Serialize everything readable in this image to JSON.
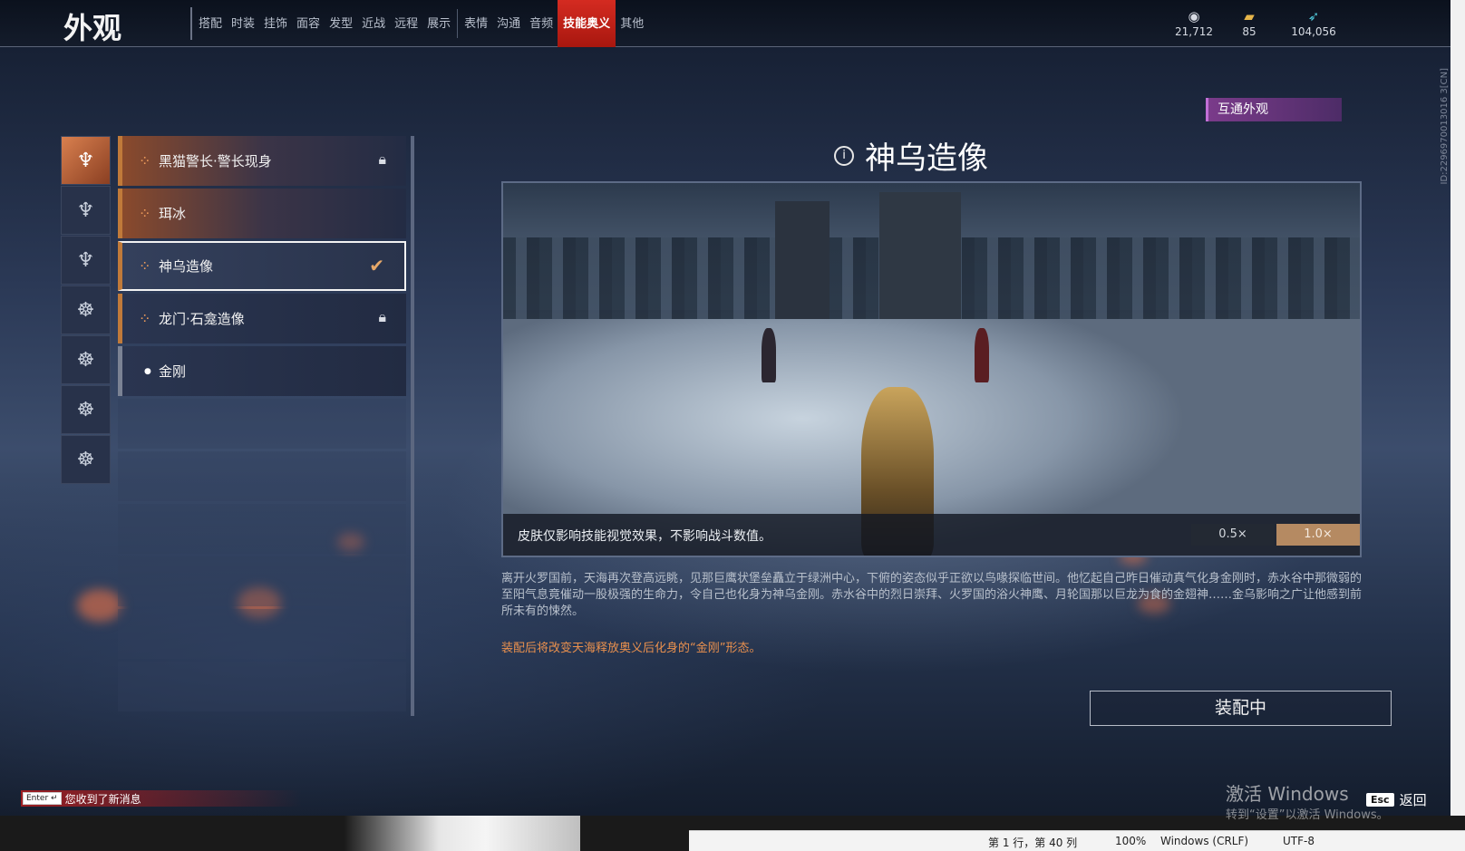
{
  "header": {
    "title": "外观",
    "tabs": [
      "搭配",
      "时装",
      "挂饰",
      "面容",
      "发型",
      "近战",
      "远程",
      "展示",
      "表情",
      "沟通",
      "音频",
      "技能奥义",
      "其他"
    ],
    "active_tab": "技能奥义",
    "currencies": [
      {
        "icon": "coin-icon",
        "value": "21,712"
      },
      {
        "icon": "ticket-icon",
        "value": "85"
      },
      {
        "icon": "feather-icon",
        "value": "104,056"
      }
    ]
  },
  "categories": [
    "cat-1",
    "cat-2",
    "cat-3",
    "cat-4",
    "cat-5",
    "cat-6",
    "cat-7"
  ],
  "skins": [
    {
      "name": "黑猫警长·警长现身",
      "status": "locked"
    },
    {
      "name": "珥冰",
      "status": "none"
    },
    {
      "name": "神乌造像",
      "status": "equipped"
    },
    {
      "name": "龙门·石龛造像",
      "status": "locked"
    },
    {
      "name": "金刚",
      "status": "default"
    }
  ],
  "detail": {
    "shared_badge": "互通外观",
    "title": "神乌造像",
    "caption": "皮肤仅影响技能视觉效果，不影响战斗数值。",
    "speed_options": [
      "0.5×",
      "1.0×"
    ],
    "active_speed": "1.0×",
    "description": "离开火罗国前，天海再次登高远眺，见那巨鹰状堡垒矗立于绿洲中心，下俯的姿态似乎正欲以鸟喙探临世间。他忆起自己昨日催动真气化身金刚时，赤水谷中那微弱的至阳气息竟催动一股极强的生命力，令自己也化身为神乌金刚。赤水谷中的烈日崇拜、火罗国的浴火神鹰、月轮国那以巨龙为食的金翅神……金乌影响之广让他感到前所未有的悚然。",
    "note": "装配后将改变天海释放奥义后化身的“金刚”形态。",
    "equip_button": "装配中"
  },
  "hud": {
    "enter_key": "Enter ↵",
    "message": "您收到了新消息",
    "esc_key": "Esc",
    "back": "返回",
    "watermark_line1": "激活 Windows",
    "watermark_line2": "转到“设置”以激活 Windows。",
    "version_id": "ID:2296970013016 3[CN]"
  },
  "statusbar": {
    "position": "第 1 行，第 40 列",
    "zoom": "100%",
    "line_ending": "Windows (CRLF)",
    "encoding": "UTF-8"
  }
}
